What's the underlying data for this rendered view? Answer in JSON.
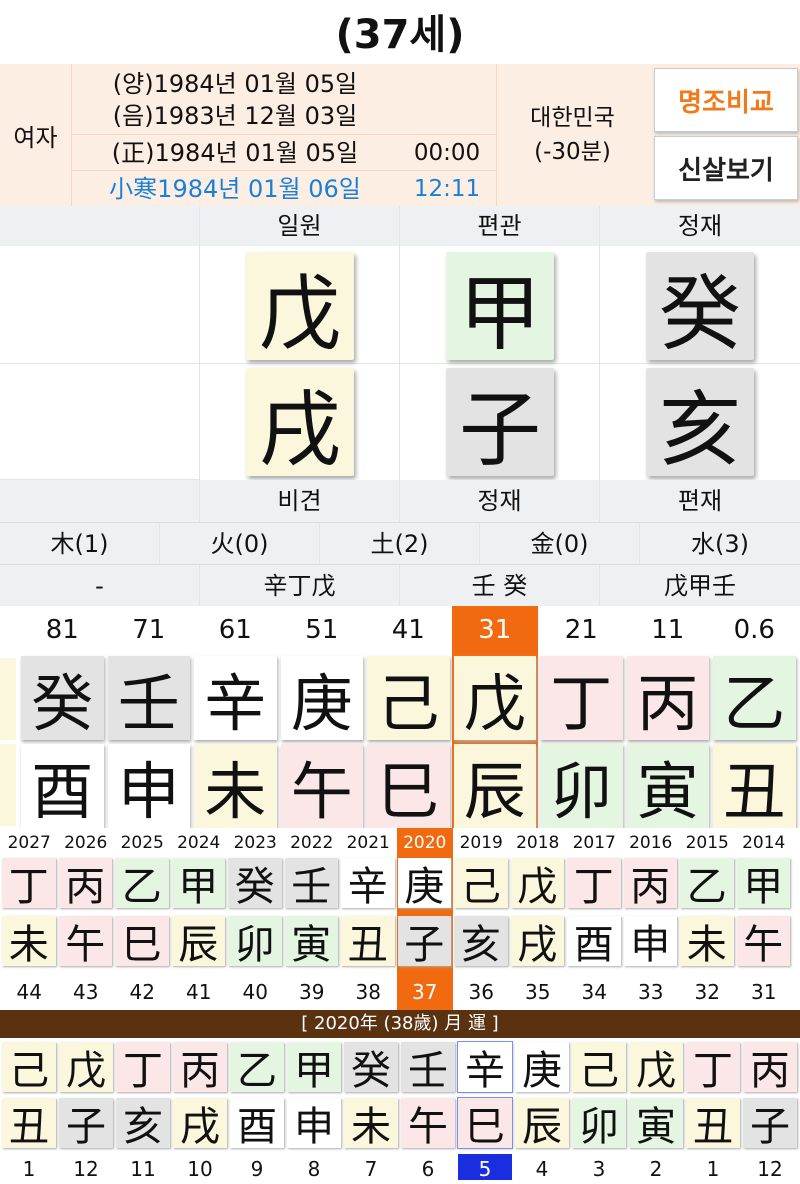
{
  "title": "(37세)",
  "info": {
    "gender": "여자",
    "solar": "(양)1984년 01월 05일",
    "lunar": "(음)1983년 12월 03일",
    "corrected": "(正)1984년 01월 05일",
    "corrected_time": "00:00",
    "term": "小寒1984년 01월 06일",
    "term_time": "12:11",
    "country": "대한민국",
    "offset": "(-30분)",
    "compare_btn": "명조비교",
    "sinsal_btn": "신살보기",
    "compare_color": "#f07a1a"
  },
  "pillars": {
    "top_labels": [
      "",
      "일원",
      "편관",
      "정재"
    ],
    "stems": [
      "",
      "戊",
      "甲",
      "癸"
    ],
    "branches": [
      "",
      "戌",
      "子",
      "亥"
    ],
    "bottom_labels": [
      "",
      "비견",
      "정재",
      "편재"
    ],
    "stem_colors": [
      "",
      "yel",
      "grn",
      "gry"
    ],
    "branch_colors": [
      "",
      "yel",
      "gry",
      "gry"
    ]
  },
  "elements": [
    "木(1)",
    "火(0)",
    "土(2)",
    "金(0)",
    "水(3)"
  ],
  "hidden": [
    "-",
    "辛丁戊",
    "壬 癸",
    "戊甲壬"
  ],
  "daeun": {
    "ages": [
      "81",
      "71",
      "61",
      "51",
      "41",
      "31",
      "21",
      "11",
      "0.6"
    ],
    "stems": [
      "癸",
      "壬",
      "辛",
      "庚",
      "己",
      "戊",
      "丁",
      "丙",
      "乙"
    ],
    "branches": [
      "酉",
      "申",
      "未",
      "午",
      "巳",
      "辰",
      "卯",
      "寅",
      "丑"
    ],
    "selected": 5,
    "highlight": "#f26a10"
  },
  "sewoon": {
    "years": [
      "2027",
      "2026",
      "2025",
      "2024",
      "2023",
      "2022",
      "2021",
      "2020",
      "2019",
      "2018",
      "2017",
      "2016",
      "2015",
      "2014"
    ],
    "stems": [
      "丁",
      "丙",
      "乙",
      "甲",
      "癸",
      "壬",
      "辛",
      "庚",
      "己",
      "戊",
      "丁",
      "丙",
      "乙",
      "甲"
    ],
    "branches": [
      "未",
      "午",
      "巳",
      "辰",
      "卯",
      "寅",
      "丑",
      "子",
      "亥",
      "戌",
      "酉",
      "申",
      "未",
      "午"
    ],
    "ages": [
      "44",
      "43",
      "42",
      "41",
      "40",
      "39",
      "38",
      "37",
      "36",
      "35",
      "34",
      "33",
      "32",
      "31"
    ],
    "selected": 7
  },
  "wolun": {
    "header": "[ 2020年 (38歲) 月 運 ]",
    "stems": [
      "己",
      "戊",
      "丁",
      "丙",
      "乙",
      "甲",
      "癸",
      "壬",
      "辛",
      "庚",
      "己",
      "戊",
      "丁",
      "丙"
    ],
    "branches": [
      "丑",
      "子",
      "亥",
      "戌",
      "酉",
      "申",
      "未",
      "午",
      "巳",
      "辰",
      "卯",
      "寅",
      "丑",
      "子"
    ],
    "months": [
      "1",
      "12",
      "11",
      "10",
      "9",
      "8",
      "7",
      "6",
      "5",
      "4",
      "3",
      "2",
      "1",
      "12"
    ],
    "selected": 8,
    "selected_color": "#1a2ee0"
  }
}
